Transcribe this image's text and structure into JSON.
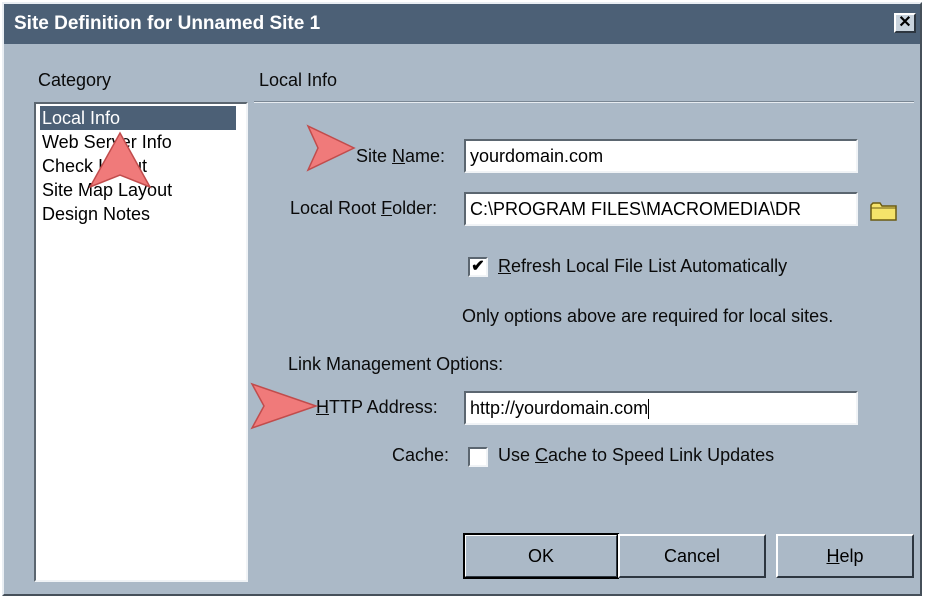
{
  "window": {
    "title": "Site Definition for Unnamed Site 1",
    "close_glyph": "✕"
  },
  "category": {
    "header": "Category",
    "items": [
      {
        "label": "Local Info",
        "selected": true
      },
      {
        "label": "Web Server Info",
        "selected": false
      },
      {
        "label": "Check In/Out",
        "selected": false
      },
      {
        "label": "Site Map Layout",
        "selected": false
      },
      {
        "label": "Design Notes",
        "selected": false
      }
    ]
  },
  "panel": {
    "header": "Local Info",
    "site_name": {
      "label_pre": "Site ",
      "label_key": "N",
      "label_post": "ame:",
      "value": "yourdomain.com"
    },
    "local_root": {
      "label_pre": "Local Root ",
      "label_key": "F",
      "label_post": "older:",
      "value": "C:\\PROGRAM FILES\\MACROMEDIA\\DR"
    },
    "refresh": {
      "checked": true,
      "label_key": "R",
      "label_post": "efresh Local File List Automatically"
    },
    "note": "Only options above are required for local sites.",
    "link_mgmt_header": "Link Management Options:",
    "http": {
      "label_key": "H",
      "label_post": "TTP Address:",
      "value": "http://yourdomain.com"
    },
    "cache": {
      "label": "Cache:",
      "checked": false,
      "label_pre": "Use ",
      "label_key": "C",
      "label_post": "ache to Speed Link Updates"
    }
  },
  "buttons": {
    "ok": "OK",
    "cancel": "Cancel",
    "help_key": "H",
    "help_post": "elp"
  },
  "icons": {
    "folder": "folder-icon",
    "annotation_arrows": "arrow-annotation-icon"
  },
  "colors": {
    "titlebar": "#4c6076",
    "dialog_bg": "#abb9c7",
    "selection": "#4c6076",
    "annotation_arrow": "#f07a7a"
  }
}
